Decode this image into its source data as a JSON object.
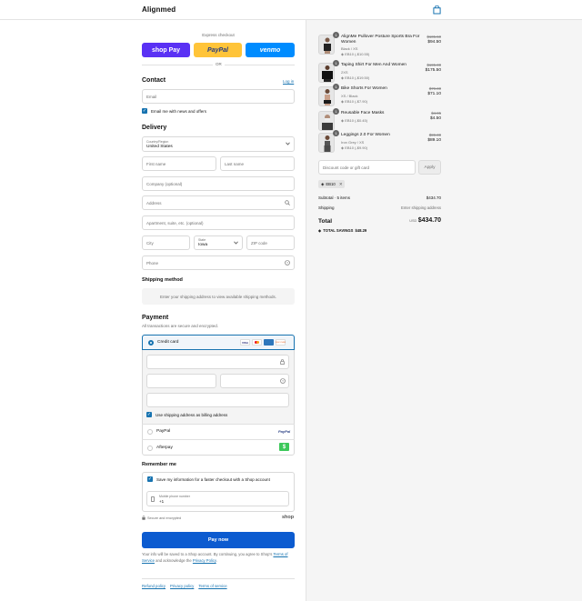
{
  "header": {
    "brand": "Alignmed"
  },
  "express": {
    "label": "Express checkout",
    "shop_pay": "shop Pay",
    "paypal": "PayPal",
    "venmo": "venmo",
    "or": "OR"
  },
  "contact": {
    "title": "Contact",
    "login": "Log in",
    "email_placeholder": "Email",
    "news_label": "Email me with news and offers"
  },
  "delivery": {
    "title": "Delivery",
    "country_label": "Country/Region",
    "country_value": "United States",
    "first_name": "First name",
    "last_name": "Last name",
    "company": "Company (optional)",
    "address": "Address",
    "apartment": "Apartment, suite, etc. (optional)",
    "city": "City",
    "state_label": "State",
    "state_value": "Iowa",
    "zip": "ZIP code",
    "phone": "Phone"
  },
  "shipping_method": {
    "title": "Shipping method",
    "note": "Enter your shipping address to view available shipping methods."
  },
  "payment": {
    "title": "Payment",
    "subtitle": "All transactions are secure and encrypted.",
    "credit_card": "Credit card",
    "card_brands": [
      "VISA",
      "MC",
      "AMEX",
      "DISCOVER"
    ],
    "billing_label": "Use shipping address as billing address",
    "paypal": "PayPal",
    "paypal_logo": "PayPal",
    "afterpay": "Afterpay",
    "afterpay_logo": "$"
  },
  "remember": {
    "title": "Remember me",
    "save_label": "Save my information for a faster checkout with a Shop account",
    "mobile_label": "Mobile phone number",
    "mobile_value": "+1",
    "secure": "Secure and encrypted",
    "shop": "shop"
  },
  "pay_now": "Pay now",
  "legal": {
    "text": "Your info will be saved to a Shop account. By continuing, you agree to Shop's",
    "terms": "Terms of Service",
    "and": "and acknowledge the",
    "privacy": "Privacy Policy",
    "end": "."
  },
  "footer_links": [
    "Refund policy",
    "Privacy policy",
    "Terms of service"
  ],
  "cart": {
    "items": [
      {
        "qty": "1",
        "name": "AlignMe Pullover Posture Sports Bra For Women",
        "variant": "Black / XS",
        "discount": "EB10 (-$10.55)",
        "old_price": "$105.50",
        "price": "$94.50"
      },
      {
        "qty": "1",
        "name": "Taping Shirt For Men And Women",
        "variant": "2XS",
        "discount": "EB10 (-$19.50)",
        "old_price": "$195.00",
        "price": "$175.50"
      },
      {
        "qty": "1",
        "name": "Bike Shorts For Women",
        "variant": "XS / Black",
        "discount": "EB10 (-$7.90)",
        "old_price": "$79.00",
        "price": "$71.10"
      },
      {
        "qty": "1",
        "name": "Reusable Face Masks",
        "variant": "",
        "discount": "EB10 (-$0.45)",
        "old_price": "$4.95",
        "price": "$4.50"
      },
      {
        "qty": "1",
        "name": "Leggings 2.0 For Women",
        "variant": "Iron Grey / XS",
        "discount": "EB10 (-$9.90)",
        "old_price": "$99.00",
        "price": "$89.10"
      }
    ],
    "discount_placeholder": "Discount code or gift card",
    "apply": "Apply",
    "code": "EB10",
    "subtotal_label": "Subtotal · 5 items",
    "subtotal_value": "$434.70",
    "shipping_label": "Shipping",
    "shipping_value": "Enter shipping address",
    "total_label": "Total",
    "currency": "USD",
    "total_value": "$434.70",
    "savings_label": "TOTAL SAVINGS",
    "savings_value": "$48.29"
  },
  "colors": {
    "accent": "#1773b0",
    "pay_button": "#0c5bd0",
    "shop_pay": "#5a31f4",
    "paypal": "#ffc439",
    "venmo": "#008cff"
  }
}
